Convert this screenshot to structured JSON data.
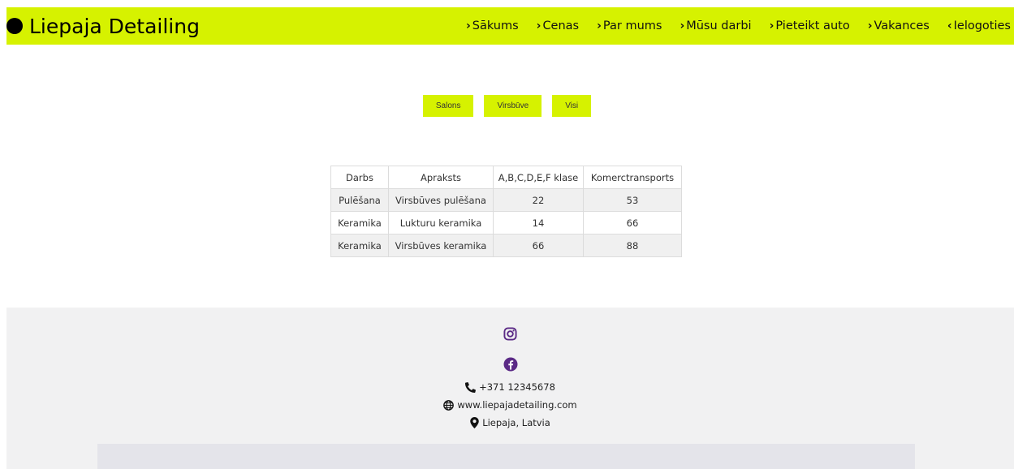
{
  "brand": {
    "name": "Liepaja Detailing"
  },
  "nav": {
    "items": [
      {
        "label": "Sākums",
        "chevron": "›"
      },
      {
        "label": "Cenas",
        "chevron": "›"
      },
      {
        "label": "Par mums",
        "chevron": "›"
      },
      {
        "label": "Mūsu darbi",
        "chevron": "›"
      },
      {
        "label": "Pieteikt auto",
        "chevron": "›"
      },
      {
        "label": "Vakances",
        "chevron": "›"
      },
      {
        "label": "Ielogoties",
        "chevron": "‹"
      }
    ]
  },
  "filters": [
    "Salons",
    "Virsbūve",
    "Visi"
  ],
  "price_table": {
    "headers": [
      "Darbs",
      "Apraksts",
      "A,B,C,D,E,F klase",
      "Komerctransports"
    ],
    "rows": [
      [
        "Pulēšana",
        "Virsbūves pulēšana",
        "22",
        "53"
      ],
      [
        "Keramika",
        "Lukturu keramika",
        "14",
        "66"
      ],
      [
        "Keramika",
        "Virsbūves keramika",
        "66",
        "88"
      ]
    ]
  },
  "footer": {
    "icons": [
      "instagram-icon",
      "facebook-icon"
    ],
    "phone": "+371 12345678",
    "website": "www.liepajadetailing.com",
    "location": "Liepaja, Latvia"
  },
  "colors": {
    "accent": "#d6f200",
    "social": "#5b2a86",
    "footer_bg": "#f1f1f2"
  }
}
